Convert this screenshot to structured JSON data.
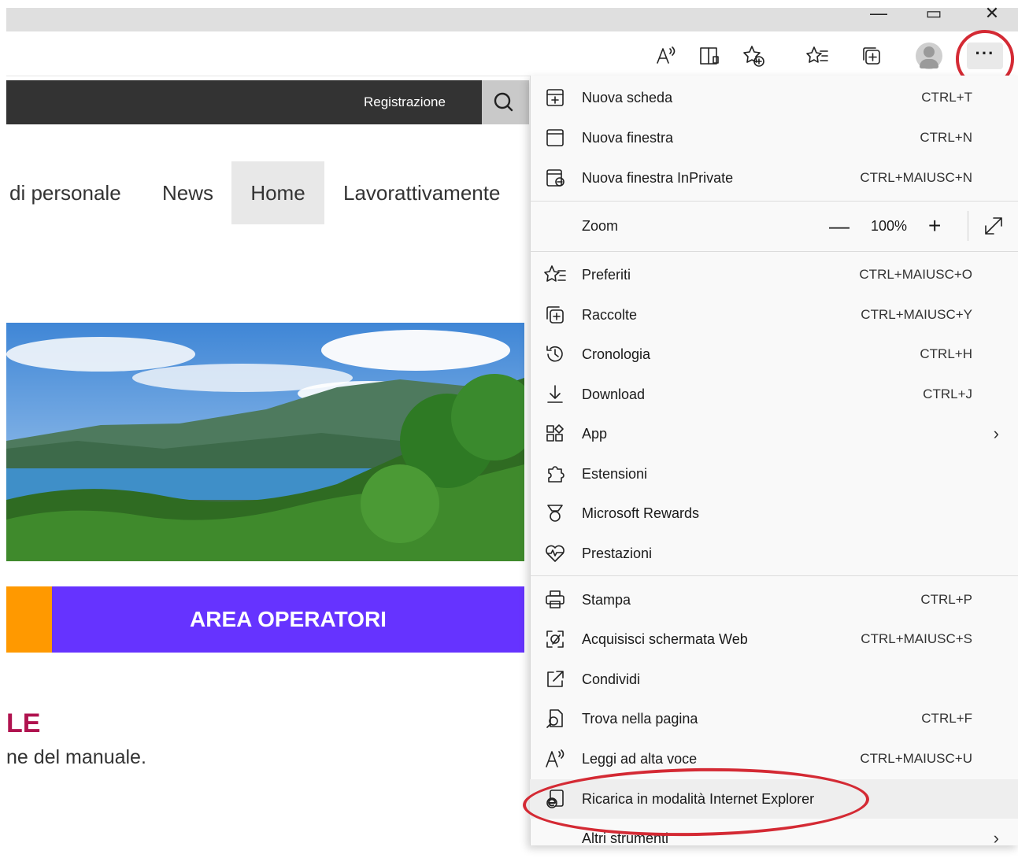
{
  "window": {
    "controls": {
      "minimize": "—",
      "restore": "▭",
      "close": "✕"
    }
  },
  "toolbar": {
    "icons": [
      "read-aloud-icon",
      "immersive-reader-icon",
      "add-favorite-icon",
      "favorites-icon",
      "collections-icon",
      "profile-icon",
      "more-icon"
    ],
    "more_label": "···"
  },
  "site": {
    "topbar": {
      "register_label": "Registrazione",
      "search_icon": "search-icon"
    },
    "nav": {
      "item1": "di personale",
      "item2": "News",
      "item3": "Home",
      "item4": "Lavorattivamente"
    },
    "banner": {
      "label": "AREA OPERATORI",
      "colors": {
        "orange": "#ff9900",
        "purple": "#6633ff"
      }
    },
    "section_title": "LE",
    "section_text": "ne del manuale."
  },
  "menu": {
    "items": [
      {
        "label": "Nuova scheda",
        "shortcut": "CTRL+T",
        "icon": "new-tab-icon"
      },
      {
        "label": "Nuova finestra",
        "shortcut": "CTRL+N",
        "icon": "new-window-icon"
      },
      {
        "label": "Nuova finestra InPrivate",
        "shortcut": "CTRL+MAIUSC+N",
        "icon": "inprivate-window-icon"
      },
      {
        "label": "Preferiti",
        "shortcut": "CTRL+MAIUSC+O",
        "icon": "favorites-icon"
      },
      {
        "label": "Raccolte",
        "shortcut": "CTRL+MAIUSC+Y",
        "icon": "collections-icon"
      },
      {
        "label": "Cronologia",
        "shortcut": "CTRL+H",
        "icon": "history-icon"
      },
      {
        "label": "Download",
        "shortcut": "CTRL+J",
        "icon": "download-icon"
      },
      {
        "label": "App",
        "shortcut": "",
        "icon": "apps-icon"
      },
      {
        "label": "Estensioni",
        "shortcut": "",
        "icon": "extensions-icon"
      },
      {
        "label": "Microsoft Rewards",
        "shortcut": "",
        "icon": "rewards-icon"
      },
      {
        "label": "Prestazioni",
        "shortcut": "",
        "icon": "performance-icon"
      },
      {
        "label": "Stampa",
        "shortcut": "CTRL+P",
        "icon": "print-icon"
      },
      {
        "label": "Acquisisci schermata Web",
        "shortcut": "CTRL+MAIUSC+S",
        "icon": "web-capture-icon"
      },
      {
        "label": "Condividi",
        "shortcut": "",
        "icon": "share-icon"
      },
      {
        "label": "Trova nella pagina",
        "shortcut": "CTRL+F",
        "icon": "find-icon"
      },
      {
        "label": "Leggi ad alta voce",
        "shortcut": "CTRL+MAIUSC+U",
        "icon": "read-aloud-icon"
      },
      {
        "label": "Ricarica in modalità Internet Explorer",
        "shortcut": "",
        "icon": "ie-mode-icon"
      },
      {
        "label": "Altri strumenti",
        "shortcut": "",
        "icon": "more-tools-icon"
      }
    ],
    "zoom": {
      "label": "Zoom",
      "minus": "—",
      "value": "100%",
      "plus": "+"
    },
    "chevron": "›",
    "highlight_color": "#d42a34"
  }
}
